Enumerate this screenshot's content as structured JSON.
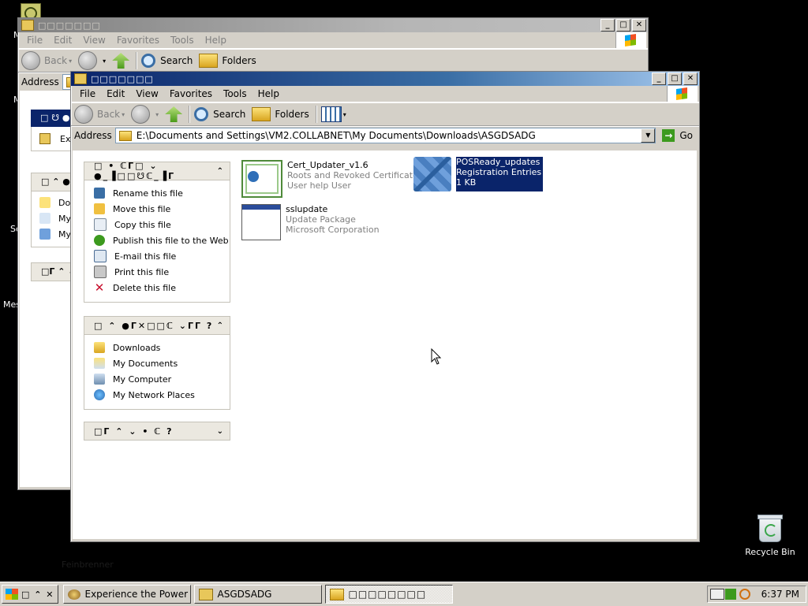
{
  "desktop": {
    "fragments": [
      "M",
      "M",
      "Sc",
      "Mes"
    ],
    "recycle_bin_label": "Recycle Bin",
    "faded_text": "Feinbrenner"
  },
  "back_window": {
    "title": "□□□□□□□",
    "menu": [
      "File",
      "Edit",
      "View",
      "Favorites",
      "Tools",
      "Help"
    ],
    "toolbar": {
      "back": "Back",
      "search": "Search",
      "folders": "Folders"
    },
    "address_label": "Address",
    "address_value": "",
    "pane1_header": "□ ☋ ●",
    "pane1_item": "Ext",
    "pane2_header": "□ ⌃ ●Γ",
    "pane2_items": [
      "Dow",
      "My",
      "My"
    ],
    "pane3_header": "□Γ ⌃ ⌄"
  },
  "front_window": {
    "title": "□□□□□□□",
    "menu": [
      "File",
      "Edit",
      "View",
      "Favorites",
      "Tools",
      "Help"
    ],
    "toolbar": {
      "back": "Back",
      "search": "Search",
      "folders": "Folders"
    },
    "address_label": "Address",
    "address_value": "E:\\Documents and Settings\\VM2.COLLABNET\\My Documents\\Downloads\\ASGDSADG",
    "go_label": "Go",
    "file_tasks": {
      "header": "□ • ℂΓ□ ⌄ ●_▐□□☋ℂ_▐Γ",
      "items": [
        {
          "label": "Rename this file",
          "icon": "rename-icon"
        },
        {
          "label": "Move this file",
          "icon": "move-icon"
        },
        {
          "label": "Copy this file",
          "icon": "copy-icon"
        },
        {
          "label": "Publish this file to the Web",
          "icon": "publish-icon"
        },
        {
          "label": "E-mail this file",
          "icon": "email-icon"
        },
        {
          "label": "Print this file",
          "icon": "print-icon"
        },
        {
          "label": "Delete this file",
          "icon": "delete-icon"
        }
      ]
    },
    "other_places": {
      "header": "□ ⌃ ●Γ✕□□ℂ ⌄ΓΓ ?",
      "items": [
        {
          "label": "Downloads",
          "icon": "folder-icon"
        },
        {
          "label": "My Documents",
          "icon": "my-documents-icon"
        },
        {
          "label": "My Computer",
          "icon": "my-computer-icon"
        },
        {
          "label": "My Network Places",
          "icon": "network-places-icon"
        }
      ]
    },
    "details": {
      "header": "□Γ ⌃ ⌄ • ℂ ?"
    },
    "files": [
      {
        "name": "Cert_Updater_v1.6",
        "line2": "Roots and Revoked Certificate...",
        "line3": "User help User",
        "icon": "certificate-icon",
        "selected": false
      },
      {
        "name": "POSReady_updates",
        "line2": "Registration Entries",
        "line3": "1 KB",
        "icon": "registry-icon",
        "selected": true
      },
      {
        "name": "sslupdate",
        "line2": "Update Package",
        "line3": "Microsoft Corporation",
        "icon": "update-package-icon",
        "selected": false
      }
    ]
  },
  "taskbar": {
    "start_label": "□ ⌃ ✕",
    "buttons": [
      {
        "label": "Experience the Power of ...",
        "pressed": false
      },
      {
        "label": "ASGDSADG",
        "pressed": false
      },
      {
        "label": "□□□□□□□□",
        "pressed": true
      }
    ],
    "clock": "6:37 PM"
  }
}
